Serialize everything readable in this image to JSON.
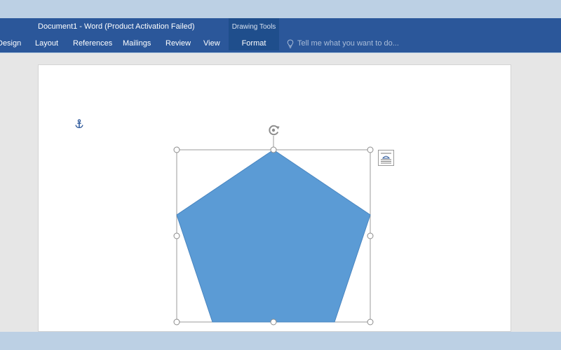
{
  "window": {
    "title": "Document1 - Word (Product Activation Failed)"
  },
  "ribbon": {
    "tabs": [
      {
        "label": "Design"
      },
      {
        "label": "Layout"
      },
      {
        "label": "References"
      },
      {
        "label": "Mailings"
      },
      {
        "label": "Review"
      },
      {
        "label": "View"
      }
    ],
    "context_group_label": "Drawing Tools",
    "context_tab_label": "Format",
    "tell_me_placeholder": "Tell me what you want to do..."
  },
  "document": {
    "selected_shape": "pentagon",
    "shape_fill": "#5b9bd5",
    "shape_outline": "#4a86c0"
  },
  "icons": {
    "anchor": "anchor-icon",
    "rotate": "rotate-handle-icon",
    "layout_options": "layout-options-icon",
    "lightbulb": "lightbulb-icon"
  },
  "colors": {
    "ribbon": "#2b579a",
    "context_group": "#1f4e8c",
    "workspace": "#e6e6e6",
    "frame": "#bcd0e4"
  }
}
